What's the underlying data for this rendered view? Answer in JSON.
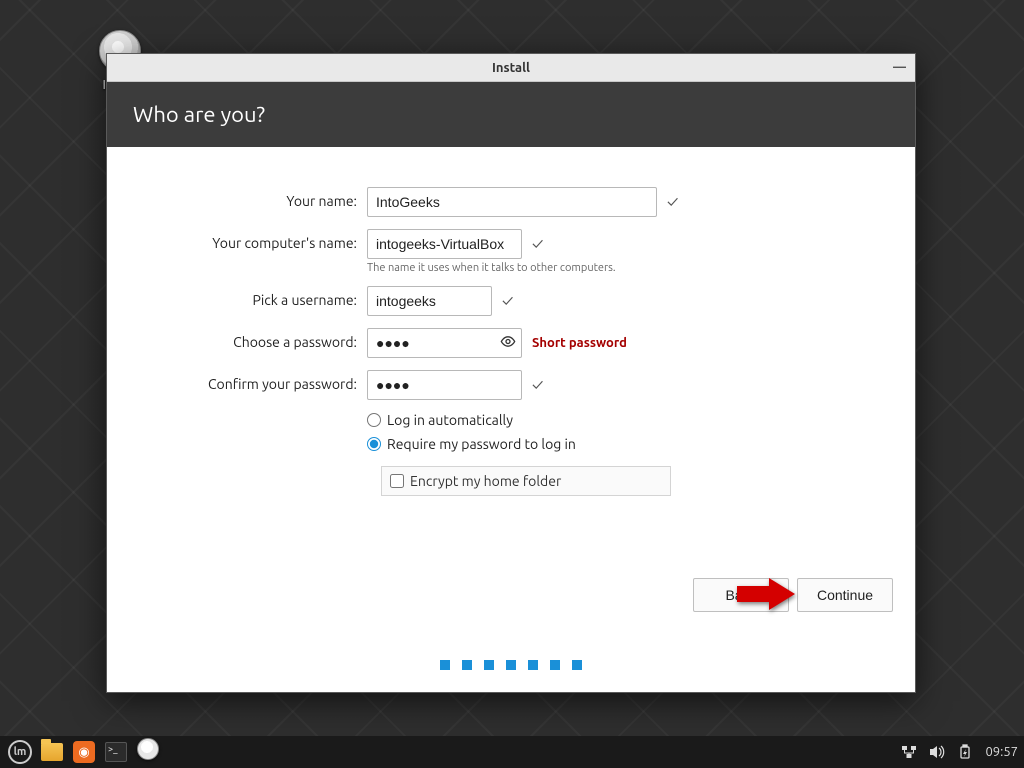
{
  "desktop": {
    "icon_label": "Install"
  },
  "window": {
    "title": "Install",
    "heading": "Who are you?"
  },
  "form": {
    "name": {
      "label": "Your name:",
      "value": "IntoGeeks"
    },
    "host": {
      "label": "Your computer's name:",
      "value": "intogeeks-VirtualBox",
      "hint": "The name it uses when it talks to other computers."
    },
    "user": {
      "label": "Pick a username:",
      "value": "intogeeks"
    },
    "pass": {
      "label": "Choose a password:",
      "value": "●●●●",
      "message": "Short password"
    },
    "confirm": {
      "label": "Confirm your password:",
      "value": "●●●●"
    },
    "login_auto": "Log in automatically",
    "login_pw": "Require my password to log in",
    "encrypt": "Encrypt my home folder"
  },
  "buttons": {
    "back": "Back",
    "continue": "Continue"
  },
  "panel": {
    "clock": "09:57"
  }
}
